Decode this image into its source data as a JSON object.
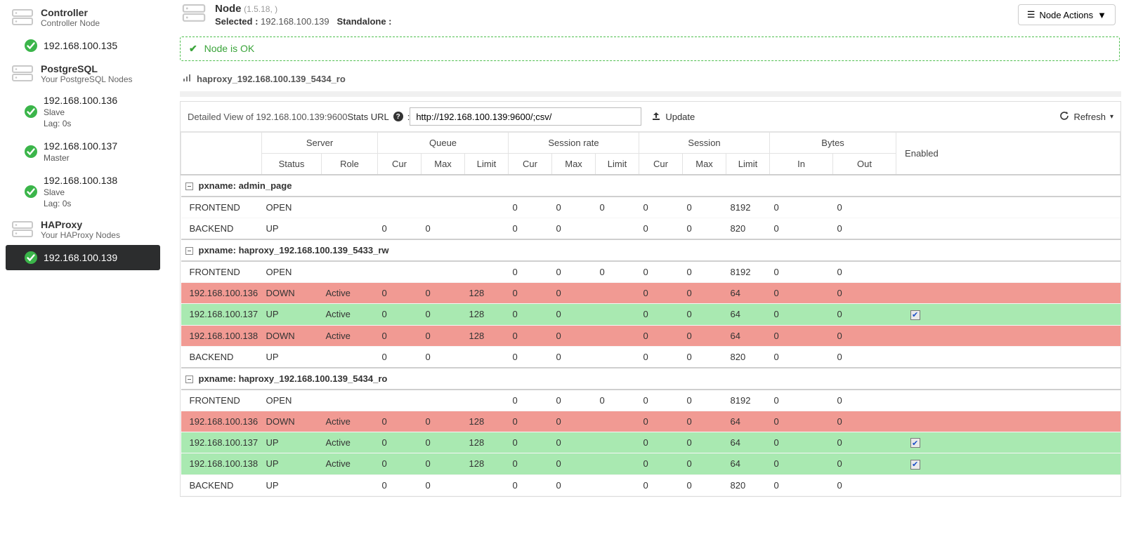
{
  "sidebar": {
    "controller": {
      "title": "Controller",
      "subtitle": "Controller Node",
      "node": "192.168.100.135"
    },
    "postgresql": {
      "title": "PostgreSQL",
      "subtitle": "Your PostgreSQL Nodes",
      "nodes": [
        {
          "ip": "192.168.100.136",
          "role": "Slave",
          "lag": "Lag: 0s"
        },
        {
          "ip": "192.168.100.137",
          "role": "Master",
          "lag": ""
        },
        {
          "ip": "192.168.100.138",
          "role": "Slave",
          "lag": "Lag: 0s"
        }
      ]
    },
    "haproxy": {
      "title": "HAProxy",
      "subtitle": "Your HAProxy Nodes",
      "nodes": [
        {
          "ip": "192.168.100.139"
        }
      ]
    }
  },
  "header": {
    "title": "Node",
    "version": "(1.5.18, )",
    "selected_label": "Selected :",
    "selected_value": "192.168.100.139",
    "topology_label": "Standalone :",
    "actions_button": "Node Actions"
  },
  "alert": {
    "text": "Node is OK"
  },
  "breadcrumb": {
    "text": "haproxy_192.168.100.139_5434_ro"
  },
  "panel": {
    "detailed_view_label": "Detailed View of 192.168.100.139:9600",
    "stats_url_label": "Stats URL",
    "stats_url_value": "http://192.168.100.139:9600/;csv/",
    "update_label": "Update",
    "refresh_label": "Refresh"
  },
  "table": {
    "headers": {
      "server": "Server",
      "queue": "Queue",
      "session_rate": "Session rate",
      "session": "Session",
      "bytes": "Bytes",
      "enabled": "Enabled",
      "status": "Status",
      "role": "Role",
      "cur": "Cur",
      "max": "Max",
      "limit": "Limit",
      "in": "In",
      "out": "Out"
    },
    "groups": [
      {
        "name": "pxname: admin_page",
        "rows": [
          {
            "server": "FRONTEND",
            "status": "OPEN",
            "role": "",
            "q_cur": "",
            "q_max": "",
            "q_lim": "",
            "sr_cur": "0",
            "sr_max": "0",
            "sr_lim": "0",
            "s_cur": "0",
            "s_max": "0",
            "s_lim": "8192",
            "b_in": "0",
            "b_out": "0",
            "enabled": false,
            "klass": ""
          },
          {
            "server": "BACKEND",
            "status": "UP",
            "role": "",
            "q_cur": "0",
            "q_max": "0",
            "q_lim": "",
            "sr_cur": "0",
            "sr_max": "0",
            "sr_lim": "",
            "s_cur": "0",
            "s_max": "0",
            "s_lim": "820",
            "b_in": "0",
            "b_out": "0",
            "enabled": false,
            "klass": ""
          }
        ]
      },
      {
        "name": "pxname: haproxy_192.168.100.139_5433_rw",
        "rows": [
          {
            "server": "FRONTEND",
            "status": "OPEN",
            "role": "",
            "q_cur": "",
            "q_max": "",
            "q_lim": "",
            "sr_cur": "0",
            "sr_max": "0",
            "sr_lim": "0",
            "s_cur": "0",
            "s_max": "0",
            "s_lim": "8192",
            "b_in": "0",
            "b_out": "0",
            "enabled": false,
            "klass": ""
          },
          {
            "server": "192.168.100.136",
            "status": "DOWN",
            "role": "Active",
            "q_cur": "0",
            "q_max": "0",
            "q_lim": "128",
            "sr_cur": "0",
            "sr_max": "0",
            "sr_lim": "",
            "s_cur": "0",
            "s_max": "0",
            "s_lim": "64",
            "b_in": "0",
            "b_out": "0",
            "enabled": false,
            "klass": "row-down"
          },
          {
            "server": "192.168.100.137",
            "status": "UP",
            "role": "Active",
            "q_cur": "0",
            "q_max": "0",
            "q_lim": "128",
            "sr_cur": "0",
            "sr_max": "0",
            "sr_lim": "",
            "s_cur": "0",
            "s_max": "0",
            "s_lim": "64",
            "b_in": "0",
            "b_out": "0",
            "enabled": true,
            "klass": "row-up"
          },
          {
            "server": "192.168.100.138",
            "status": "DOWN",
            "role": "Active",
            "q_cur": "0",
            "q_max": "0",
            "q_lim": "128",
            "sr_cur": "0",
            "sr_max": "0",
            "sr_lim": "",
            "s_cur": "0",
            "s_max": "0",
            "s_lim": "64",
            "b_in": "0",
            "b_out": "0",
            "enabled": false,
            "klass": "row-down"
          },
          {
            "server": "BACKEND",
            "status": "UP",
            "role": "",
            "q_cur": "0",
            "q_max": "0",
            "q_lim": "",
            "sr_cur": "0",
            "sr_max": "0",
            "sr_lim": "",
            "s_cur": "0",
            "s_max": "0",
            "s_lim": "820",
            "b_in": "0",
            "b_out": "0",
            "enabled": false,
            "klass": ""
          }
        ]
      },
      {
        "name": "pxname: haproxy_192.168.100.139_5434_ro",
        "rows": [
          {
            "server": "FRONTEND",
            "status": "OPEN",
            "role": "",
            "q_cur": "",
            "q_max": "",
            "q_lim": "",
            "sr_cur": "0",
            "sr_max": "0",
            "sr_lim": "0",
            "s_cur": "0",
            "s_max": "0",
            "s_lim": "8192",
            "b_in": "0",
            "b_out": "0",
            "enabled": false,
            "klass": ""
          },
          {
            "server": "192.168.100.136",
            "status": "DOWN",
            "role": "Active",
            "q_cur": "0",
            "q_max": "0",
            "q_lim": "128",
            "sr_cur": "0",
            "sr_max": "0",
            "sr_lim": "",
            "s_cur": "0",
            "s_max": "0",
            "s_lim": "64",
            "b_in": "0",
            "b_out": "0",
            "enabled": false,
            "klass": "row-down"
          },
          {
            "server": "192.168.100.137",
            "status": "UP",
            "role": "Active",
            "q_cur": "0",
            "q_max": "0",
            "q_lim": "128",
            "sr_cur": "0",
            "sr_max": "0",
            "sr_lim": "",
            "s_cur": "0",
            "s_max": "0",
            "s_lim": "64",
            "b_in": "0",
            "b_out": "0",
            "enabled": true,
            "klass": "row-up"
          },
          {
            "server": "192.168.100.138",
            "status": "UP",
            "role": "Active",
            "q_cur": "0",
            "q_max": "0",
            "q_lim": "128",
            "sr_cur": "0",
            "sr_max": "0",
            "sr_lim": "",
            "s_cur": "0",
            "s_max": "0",
            "s_lim": "64",
            "b_in": "0",
            "b_out": "0",
            "enabled": true,
            "klass": "row-up"
          },
          {
            "server": "BACKEND",
            "status": "UP",
            "role": "",
            "q_cur": "0",
            "q_max": "0",
            "q_lim": "",
            "sr_cur": "0",
            "sr_max": "0",
            "sr_lim": "",
            "s_cur": "0",
            "s_max": "0",
            "s_lim": "820",
            "b_in": "0",
            "b_out": "0",
            "enabled": false,
            "klass": ""
          }
        ]
      }
    ]
  }
}
